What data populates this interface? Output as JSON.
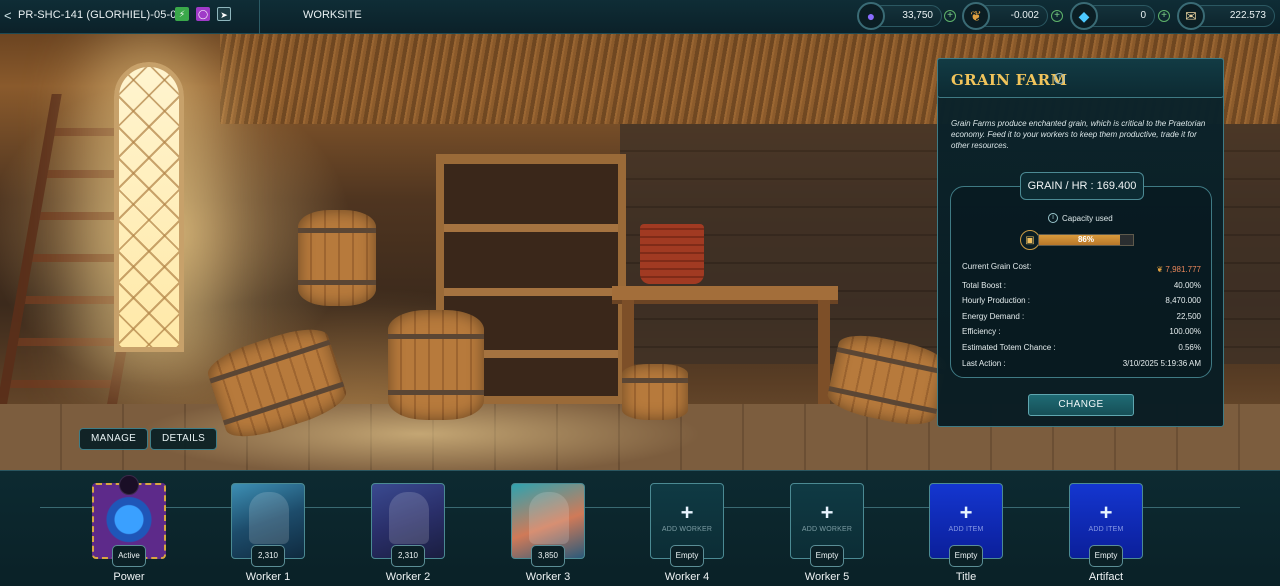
{
  "header": {
    "back_glyph": "<",
    "building_code": "PR-SHC-141 (GLORHIEL)-05-077",
    "section": "WORKSITE",
    "badges": [
      {
        "name": "energy-badge",
        "glyph": "⚡",
        "color": "#3aa84a"
      },
      {
        "name": "ring-badge",
        "glyph": "◯",
        "color": "#a03ac8"
      },
      {
        "name": "arrow-badge",
        "glyph": "➤",
        "color": "#1d3d45"
      }
    ]
  },
  "resources": [
    {
      "name": "essence",
      "icon": "purple-orb-icon",
      "glyph": "●",
      "color": "#8a6cff",
      "value": "33,750"
    },
    {
      "name": "grain",
      "icon": "grain-icon",
      "glyph": "❦",
      "color": "#e0a040",
      "value": "-0.002"
    },
    {
      "name": "crystal",
      "icon": "crystal-icon",
      "glyph": "◆",
      "color": "#4cc9ff",
      "value": "0"
    },
    {
      "name": "scroll",
      "icon": "scroll-icon",
      "glyph": "✉",
      "color": "#e8d2a0",
      "value": "222.573"
    }
  ],
  "scene": {
    "manage_label": "MANAGE",
    "details_label": "DETAILS"
  },
  "panel": {
    "title": "GRAIN FARM",
    "description": "Grain Farms produce enchanted grain, which is critical to the Praetorian economy. Feed it to your workers to keep them productive, trade it for other resources.",
    "rate_label": "GRAIN / HR : 169.400",
    "capacity_label": "Capacity used",
    "capacity_percent": 86,
    "capacity_text": "86%",
    "grain_cost_label": "Current Grain Cost:",
    "grain_cost_value": "7,981.777",
    "stats": [
      {
        "label": "Total Boost :",
        "value": "40.00%"
      },
      {
        "label": "Hourly Production :",
        "value": "8,470.000"
      },
      {
        "label": "Energy Demand :",
        "value": "22,500"
      },
      {
        "label": "Efficiency :",
        "value": "100.00%"
      },
      {
        "label": "Estimated Totem Chance :",
        "value": "0.56%"
      },
      {
        "label": "Last Action :",
        "value": "3/10/2025 5:19:36 AM"
      }
    ],
    "change_label": "CHANGE"
  },
  "slots": [
    {
      "kind": "power",
      "badge": "Active",
      "label": "Power"
    },
    {
      "kind": "w1",
      "badge": "2,310",
      "label": "Worker 1"
    },
    {
      "kind": "w2",
      "badge": "2,310",
      "label": "Worker 2"
    },
    {
      "kind": "w3",
      "badge": "3,850",
      "label": "Worker 3"
    },
    {
      "kind": "empty-w",
      "add_label": "ADD WORKER",
      "badge": "Empty",
      "label": "Worker 4"
    },
    {
      "kind": "empty-w",
      "add_label": "ADD WORKER",
      "badge": "Empty",
      "label": "Worker 5"
    },
    {
      "kind": "empty-i",
      "add_label": "ADD ITEM",
      "badge": "Empty",
      "label": "Title"
    },
    {
      "kind": "empty-i",
      "add_label": "ADD ITEM",
      "badge": "Empty",
      "label": "Artifact"
    }
  ]
}
